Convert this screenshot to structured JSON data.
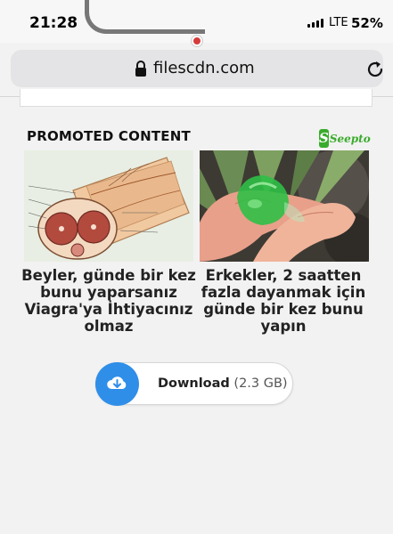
{
  "status_bar": {
    "time": "21:28",
    "network": "LTE",
    "battery": "52%"
  },
  "browser": {
    "url": "filescdn.com",
    "icons": [
      "lock-icon",
      "reload-icon"
    ]
  },
  "promoted": {
    "heading": "PROMOTED CONTENT",
    "sponsor_logo_text": "Seepto",
    "cards": [
      {
        "title": "Beyler, günde bir kez bunu yaparsanız Viagra'ya İhtiyacınız olmaz",
        "image": "anatomical-illustration"
      },
      {
        "title": "Erkekler, 2 saatten fazla dayanmak için günde bir kez bunu yapın",
        "image": "green-gel-on-fingers"
      }
    ]
  },
  "download": {
    "label": "Download",
    "size": "(2.3 GB)",
    "icon": "cloud-download-icon",
    "accent_color": "#2f8ee8"
  }
}
